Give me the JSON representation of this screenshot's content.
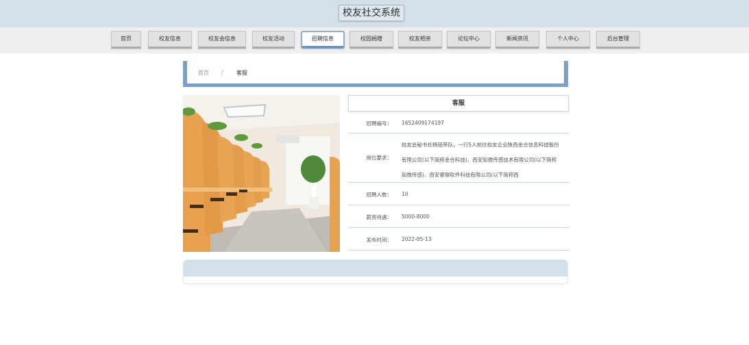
{
  "header": {
    "title": "校友社交系统"
  },
  "nav": {
    "items": [
      {
        "label": "首页"
      },
      {
        "label": "校友信息"
      },
      {
        "label": "校友会信息"
      },
      {
        "label": "校友活动"
      },
      {
        "label": "招聘信息"
      },
      {
        "label": "校园捐赠"
      },
      {
        "label": "校友相亲"
      },
      {
        "label": "论坛中心"
      },
      {
        "label": "新闻资讯"
      },
      {
        "label": "个人中心"
      },
      {
        "label": "后台管理"
      }
    ],
    "active_index": 4
  },
  "breadcrumb": {
    "home": "首页",
    "separator": "/",
    "current": "客服"
  },
  "detail": {
    "title": "客服",
    "fields": [
      {
        "label": "招聘编号：",
        "value": "1652409174197"
      },
      {
        "label": "岗位要求：",
        "value": "校友会秘书长杨铭带队，一行5人前往校友企业陕西金合信息科技股份有限公司(以下简称金合科技)、西安知微传感技术有限公司(以下简称知微传感)、西安睿聊软件科技有限公司(以下简称西"
      },
      {
        "label": "招聘人数：",
        "value": "10"
      },
      {
        "label": "薪资待遇：",
        "value": "5000-8000"
      },
      {
        "label": "发布时间：",
        "value": "2022-05-13"
      }
    ]
  },
  "colors": {
    "accent": "#7a9fc8",
    "header_bg": "#d3dfe9",
    "nav_bg": "#efefef"
  },
  "icons": {
    "photo": "study-room-image"
  }
}
